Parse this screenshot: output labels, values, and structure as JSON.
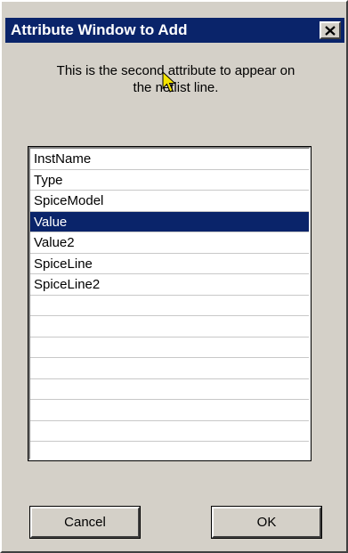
{
  "window": {
    "title": "Attribute Window to Add",
    "close_label": "×"
  },
  "message": {
    "line1": "This is the second attribute to appear on",
    "line2": "the netlist line."
  },
  "list": {
    "items": [
      "InstName",
      "Type",
      "SpiceModel",
      "Value",
      "Value2",
      "SpiceLine",
      "SpiceLine2",
      "",
      "",
      "",
      "",
      "",
      "",
      "",
      ""
    ],
    "selected_index": 3
  },
  "buttons": {
    "cancel": "Cancel",
    "ok": "OK"
  },
  "colors": {
    "titlebar": "#0a246a",
    "selection": "#0a246a",
    "dialog_bg": "#d4d0c8"
  },
  "icons": {
    "close": "close-icon",
    "cursor": "mouse-pointer-icon"
  }
}
